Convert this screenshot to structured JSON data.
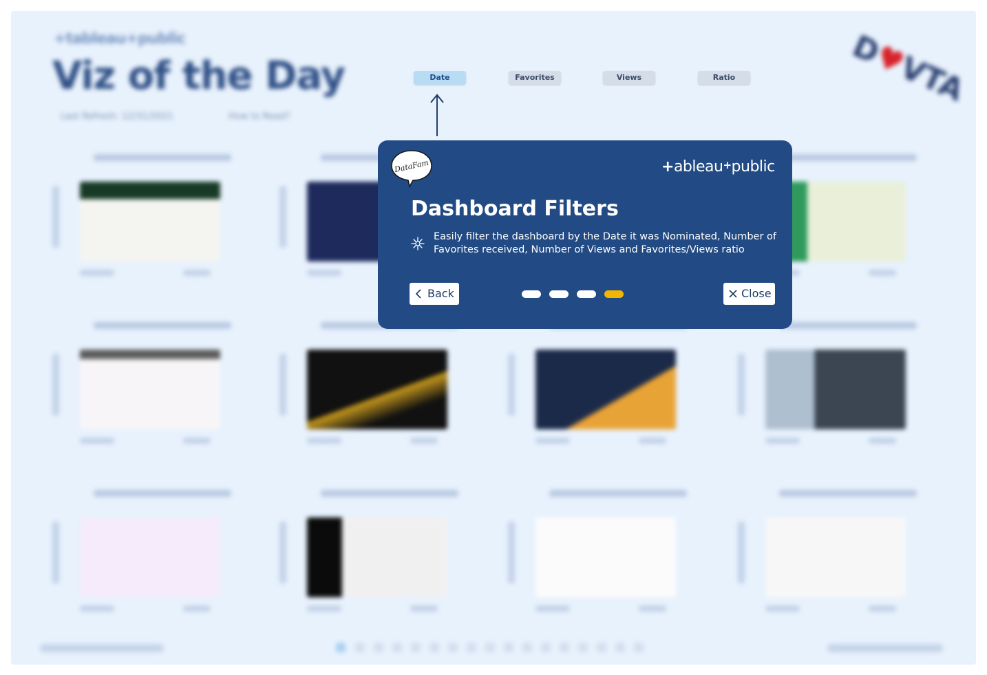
{
  "background": {
    "logo": "+tableau+public",
    "title": "Viz of the Day",
    "meta": [
      "Last Refresh: 12/31/2021",
      "How to Read?"
    ],
    "brand": {
      "letters_before": "D",
      "letters_after": "VTA"
    }
  },
  "filters": [
    {
      "label": "Date",
      "active": true
    },
    {
      "label": "Favorites",
      "active": false
    },
    {
      "label": "Views",
      "active": false
    },
    {
      "label": "Ratio",
      "active": false
    }
  ],
  "modal": {
    "badge_text": "DataFam",
    "logo": {
      "plus": "+",
      "ableau": "ableau",
      "sep": "+",
      "public": "public"
    },
    "title": "Dashboard Filters",
    "description": "Easily filter the dashboard by the Date it was Nominated, Number of Favorites received, Number of Views and Favorites/Views ratio",
    "back_label": "Back",
    "close_label": "Close",
    "steps": 4,
    "current_step": 4,
    "colors": {
      "panel": "#224a84",
      "active_step": "#f2b600"
    }
  }
}
